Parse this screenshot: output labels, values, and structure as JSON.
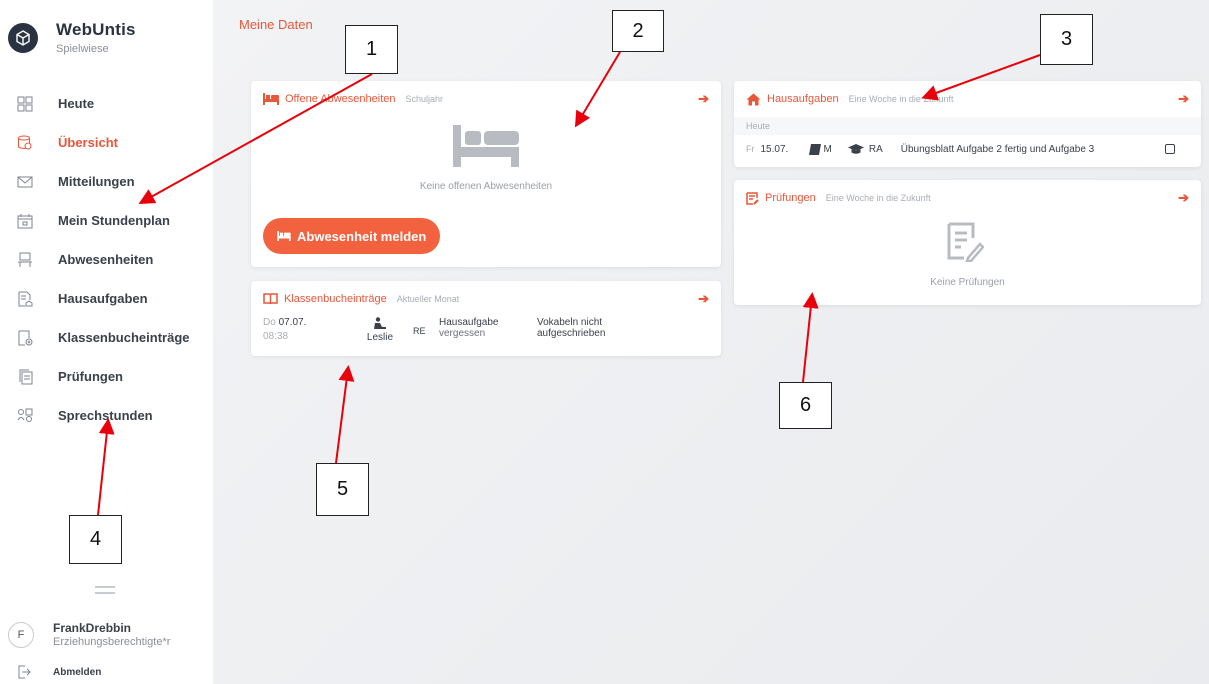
{
  "brand": {
    "title": "WebUntis",
    "subtitle": "Spielwiese"
  },
  "nav": {
    "items": [
      {
        "label": "Heute",
        "icon": "grid-icon"
      },
      {
        "label": "Übersicht",
        "icon": "overview-icon",
        "active": true
      },
      {
        "label": "Mitteilungen",
        "icon": "mail-icon"
      },
      {
        "label": "Mein Stundenplan",
        "icon": "calendar-icon"
      },
      {
        "label": "Abwesenheiten",
        "icon": "absence-icon"
      },
      {
        "label": "Hausaufgaben",
        "icon": "homework-icon"
      },
      {
        "label": "Klassenbucheinträge",
        "icon": "classbook-icon"
      },
      {
        "label": "Prüfungen",
        "icon": "exam-icon"
      },
      {
        "label": "Sprechstunden",
        "icon": "consultation-icon"
      }
    ]
  },
  "user": {
    "initial": "F",
    "name": "FrankDrebbin",
    "role": "Erziehungsberechtigte*r",
    "logout": "Abmelden"
  },
  "page": {
    "title": "Meine Daten"
  },
  "absences": {
    "title": "Offene Abwesenheiten",
    "subtitle": "Schuljahr",
    "empty": "Keine offenen Abwesenheiten",
    "button": "Abwesenheit melden"
  },
  "homework": {
    "title": "Hausaufgaben",
    "subtitle": "Eine Woche in die Zukunft",
    "section": "Heute",
    "row": {
      "day": "Fr",
      "date": "15.07.",
      "subject": "M",
      "teacher": "RA",
      "text": "Übungsblatt Aufgabe 2 fertig und Aufgabe 3"
    }
  },
  "exams": {
    "title": "Prüfungen",
    "subtitle": "Eine Woche in die Zukunft",
    "empty": "Keine Prüfungen"
  },
  "classbook": {
    "title": "Klassenbucheinträge",
    "subtitle": "Aktueller Monat",
    "row": {
      "day": "Do",
      "date": "07.07.",
      "time": "08:38",
      "student": "Leslie",
      "subject": "RE",
      "reason_1": "Hausaufgabe",
      "reason_2": "vergessen",
      "note_1": "Vokabeln nicht",
      "note_2": "aufgeschrieben"
    }
  },
  "annotations": [
    "1",
    "2",
    "3",
    "4",
    "5",
    "6"
  ],
  "colors": {
    "accent": "#e8573a",
    "button": "#f2623f",
    "sidebar_text": "#3a414b",
    "arrow": "#e8000b"
  }
}
